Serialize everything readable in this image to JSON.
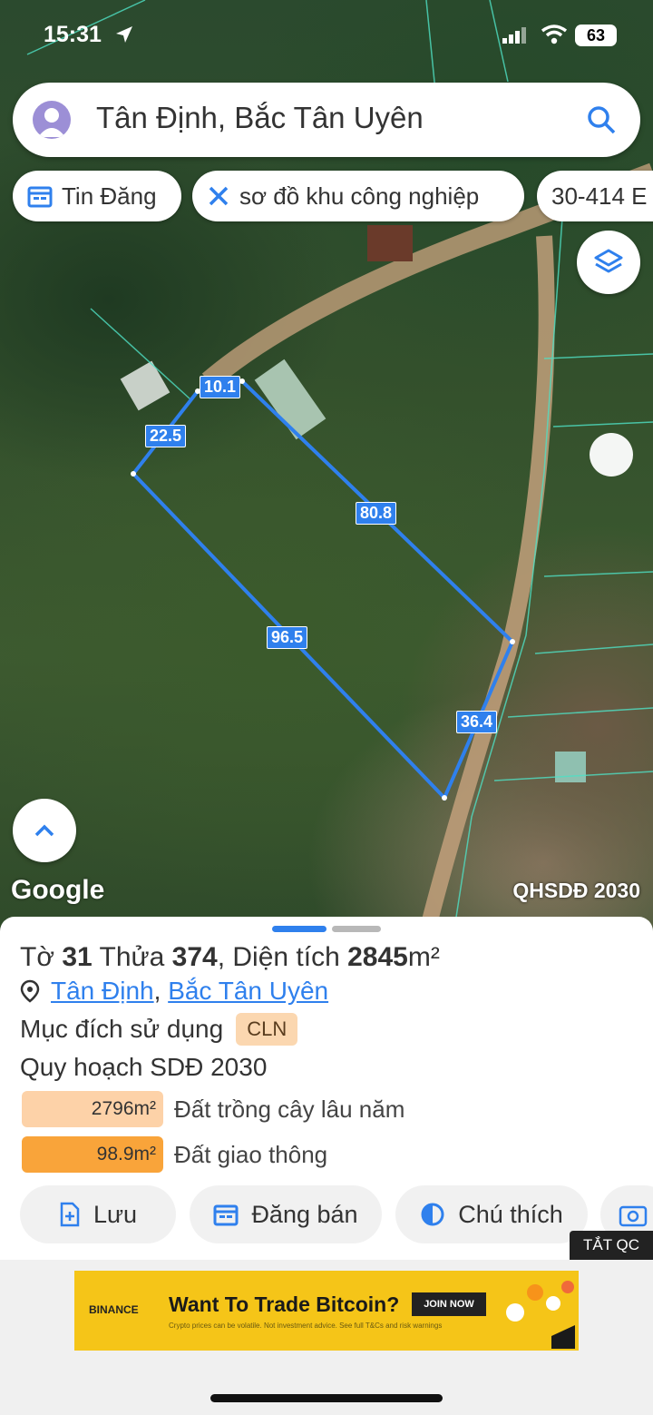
{
  "status_bar": {
    "time": "15:31",
    "battery": "63"
  },
  "search": {
    "query": "Tân Định, Bắc Tân Uyên"
  },
  "chips": [
    {
      "label": "Tin Đăng",
      "icon": "calendar-icon"
    },
    {
      "label": "sơ đồ khu công nghiệp",
      "icon": "tools-icon"
    },
    {
      "label": "30-414 E"
    }
  ],
  "map": {
    "logo": "Google",
    "layer_label": "QHSDĐ 2030",
    "edges": [
      "10.1",
      "22.5",
      "80.8",
      "96.5",
      "36.4"
    ]
  },
  "parcel": {
    "sheet_prefix": "Tờ",
    "sheet_no": "31",
    "plot_prefix": "Thửa",
    "plot_no": "374",
    "area_prefix": "Diện tích",
    "area_value": "2845",
    "area_unit": "m²",
    "location_commune": "Tân Định",
    "location_district": "Bắc Tân Uyên",
    "purpose_label": "Mục đích sử dụng",
    "purpose_code": "CLN",
    "plan_title": "Quy hoạch SDĐ 2030",
    "plan_items": [
      {
        "area": "2796m²",
        "label": "Đất trồng cây lâu năm",
        "color": "#fdd2a8"
      },
      {
        "area": "98.9m²",
        "label": "Đất giao thông",
        "color": "#f9a43a"
      }
    ]
  },
  "actions": [
    {
      "label": "Lưu",
      "icon": "save-icon"
    },
    {
      "label": "Đăng bán",
      "icon": "calendar-icon"
    },
    {
      "label": "Chú thích",
      "icon": "contrast-icon"
    },
    {
      "label": "",
      "icon": "camera-icon"
    }
  ],
  "ad": {
    "close_label": "TẮT QC",
    "brand": "BINANCE",
    "headline": "Want To Trade Bitcoin?",
    "cta": "JOIN NOW",
    "small": "Crypto prices can be volatile. Not investment advice. See full T&Cs and risk warnings"
  },
  "colors": {
    "accent": "#2f80ed",
    "parcel_line": "#2f80ed"
  }
}
